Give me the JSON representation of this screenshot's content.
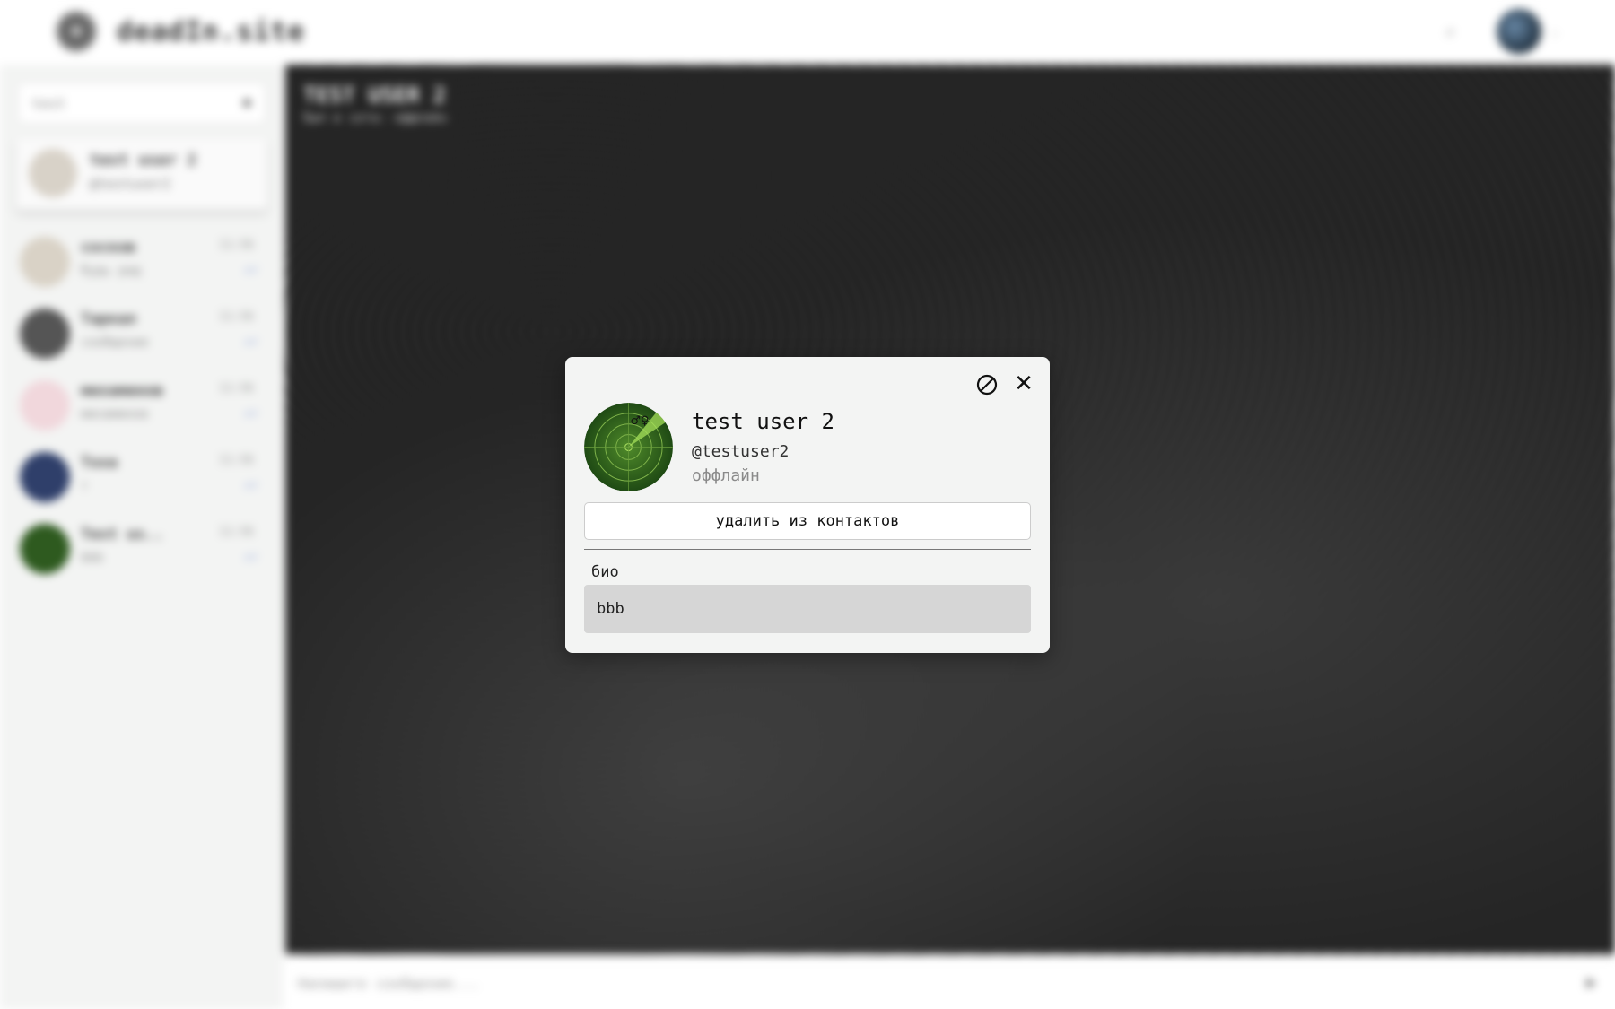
{
  "app": {
    "brand_name": "deadIn.site"
  },
  "sidebar": {
    "search_value": "test",
    "search_result": {
      "name": "test user 2",
      "handle": "@testuser2"
    },
    "chats": [
      {
        "name": "сосков",
        "preview": "будь рад",
        "time": "11:56",
        "avatar_color": "#d9d2c6"
      },
      {
        "name": "Таркал",
        "preview": "сообщение",
        "time": "11:56",
        "avatar_color": "#555555"
      },
      {
        "name": "михаминов",
        "preview": "михаминов",
        "time": "11:56",
        "avatar_color": "#f1d7dc"
      },
      {
        "name": "Тоха",
        "preview": "т",
        "time": "11:56",
        "avatar_color": "#2f3f6a"
      },
      {
        "name": "Test us..",
        "preview": "bbb",
        "time": "11:56",
        "avatar_color": "#2e5a1f"
      }
    ]
  },
  "main": {
    "chat_title": "TEST USER 2",
    "chat_status": "был в сети: оффлайн",
    "composer_placeholder": "Напишите сообщение..."
  },
  "modal": {
    "name": "test user 2",
    "handle": "@testuser2",
    "status": "оффлайн",
    "remove_button_label": "удалить из контактов",
    "bio_label": "био",
    "bio_value": "bbb",
    "close_glyph": "✕",
    "block_icon": "block-icon",
    "avatar_colors": {
      "outer": "#2e5a1f",
      "inner": "#4a7f2c",
      "highlight": "#a6e05a"
    }
  }
}
